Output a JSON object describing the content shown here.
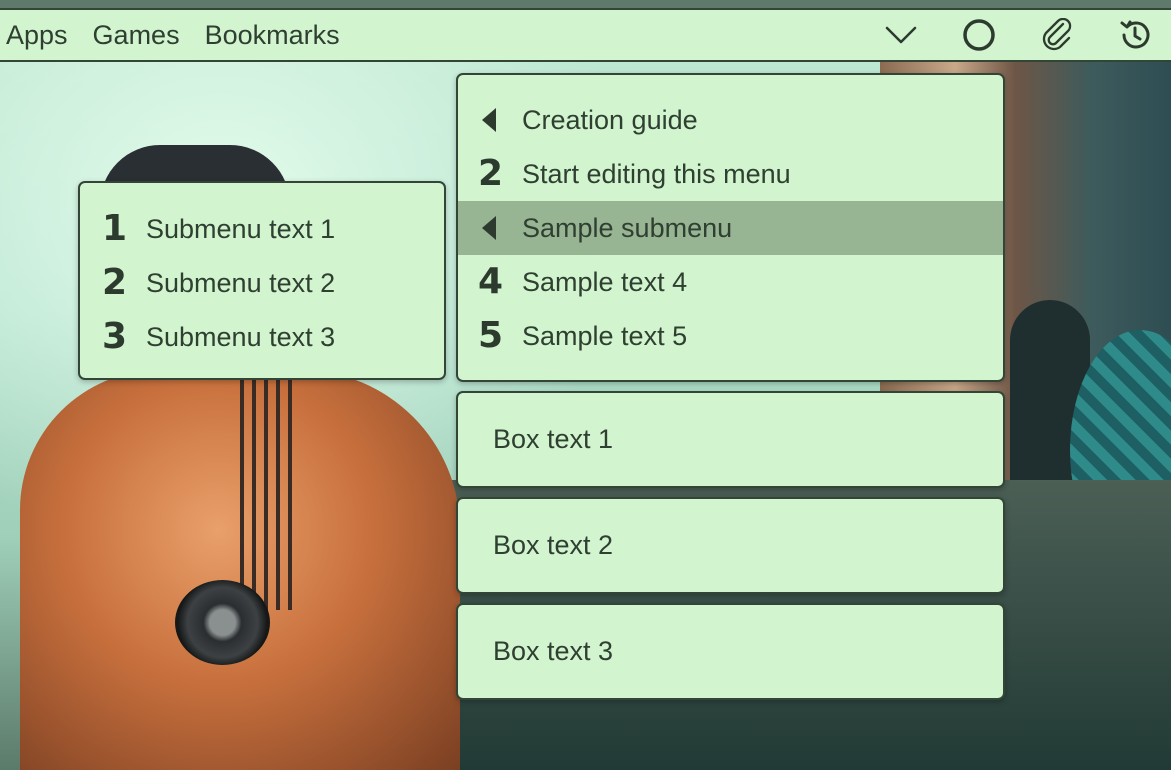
{
  "topbar": {
    "menu": [
      "Apps",
      "Games",
      "Bookmarks"
    ],
    "icons": [
      "chevron-down-icon",
      "circle-icon",
      "paperclip-icon",
      "history-icon"
    ]
  },
  "main_menu": {
    "items": [
      {
        "marker": "triangle-left",
        "label": "Creation guide"
      },
      {
        "marker": "2",
        "label": "Start editing this menu"
      },
      {
        "marker": "triangle-left",
        "label": "Sample submenu",
        "active": true
      },
      {
        "marker": "4",
        "label": "Sample text 4"
      },
      {
        "marker": "5",
        "label": "Sample text 5"
      }
    ]
  },
  "submenu": {
    "items": [
      {
        "marker": "1",
        "label": "Submenu text 1"
      },
      {
        "marker": "2",
        "label": "Submenu text 2"
      },
      {
        "marker": "3",
        "label": "Submenu text 3"
      }
    ]
  },
  "boxes": [
    "Box text 1",
    "Box text 2",
    "Box text 3"
  ],
  "colors": {
    "panel_bg": "#d2f5cf",
    "border": "#334536",
    "active_row": "#97b493",
    "text": "#2f3f31"
  }
}
